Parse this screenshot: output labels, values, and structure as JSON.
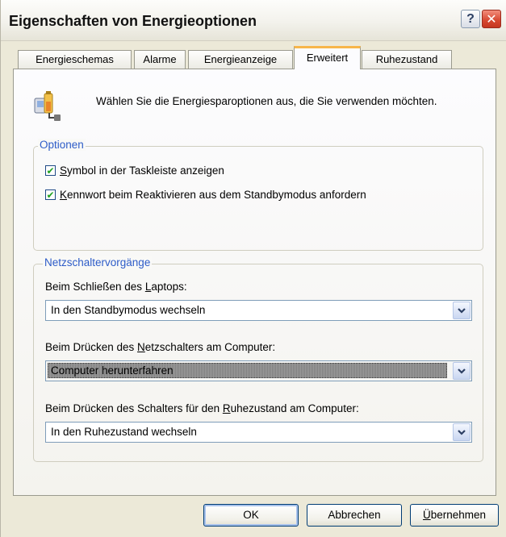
{
  "window": {
    "title": "Eigenschaften von Energieoptionen",
    "help_label": "?",
    "close_label": "✕"
  },
  "tabs": [
    {
      "label": "Energieschemas",
      "active": false
    },
    {
      "label": "Alarme",
      "active": false
    },
    {
      "label": "Energieanzeige",
      "active": false
    },
    {
      "label": "Erweitert",
      "active": true
    },
    {
      "label": "Ruhezustand",
      "active": false
    }
  ],
  "header": {
    "icon": "power-options-icon",
    "text": "Wählen Sie die Energiesparoptionen aus, die Sie verwenden möchten."
  },
  "options": {
    "legend": "Optionen",
    "items": [
      {
        "label_pre": "",
        "accel": "S",
        "label_post": "ymbol in der Taskleiste anzeigen",
        "checked": true
      },
      {
        "label_pre": "",
        "accel": "K",
        "label_post": "ennwort beim Reaktivieren aus dem Standbymodus anfordern",
        "checked": true
      }
    ]
  },
  "power_buttons": {
    "legend": "Netzschaltervorgänge",
    "fields": [
      {
        "label_pre": "Beim Schließen des ",
        "accel": "L",
        "label_post": "aptops:",
        "value": "In den Standbymodus wechseln",
        "focused": false
      },
      {
        "label_pre": "Beim Drücken des ",
        "accel": "N",
        "label_post": "etzschalters am Computer:",
        "value": "Computer herunterfahren",
        "focused": true
      },
      {
        "label_pre": "Beim Drücken des Schalters für den ",
        "accel": "R",
        "label_post": "uhezustand am Computer:",
        "value": "In den Ruhezustand wechseln",
        "focused": false
      }
    ]
  },
  "buttons": {
    "ok": "OK",
    "cancel": "Abbrechen",
    "apply_accel": "Ü",
    "apply_rest": "bernehmen"
  },
  "colors": {
    "dialog_bg": "#ece9d8",
    "group_label": "#2d5cc8",
    "active_tab_accent": "#f7b64a"
  }
}
